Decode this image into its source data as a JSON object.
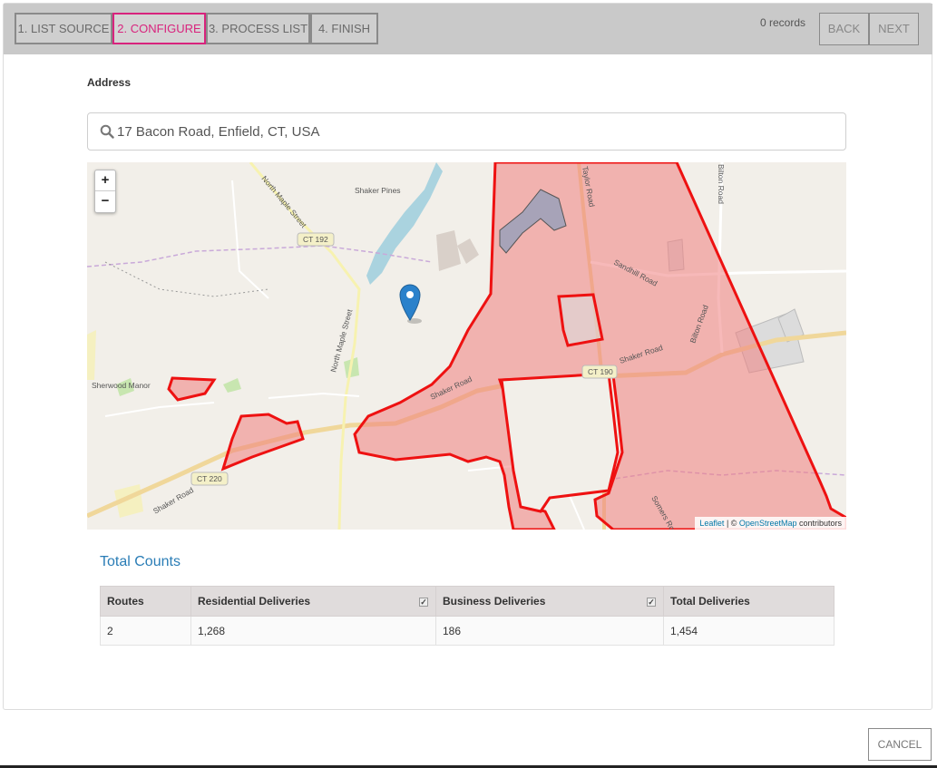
{
  "wizard": {
    "steps": [
      {
        "label": "1. LIST SOURCE"
      },
      {
        "label": "2. CONFIGURE"
      },
      {
        "label": "3. PROCESS LIST"
      },
      {
        "label": "4. FINISH"
      }
    ],
    "active_step": 2,
    "records": "0 records",
    "back_label": "BACK",
    "next_label": "NEXT"
  },
  "address": {
    "label": "Address",
    "value": "17 Bacon Road, Enfield, CT, USA"
  },
  "map": {
    "zoom_in": "+",
    "zoom_out": "−",
    "attribution_leaflet": "Leaflet",
    "attribution_sep": " | © ",
    "attribution_osm": "OpenStreetMap",
    "attribution_tail": " contributors",
    "labels": {
      "shaker_pines": "Shaker Pines",
      "ct192": "CT 192",
      "north_maple_1": "North Maple Street",
      "north_maple_2": "North Maple Street",
      "taylor_road": "Taylor Road",
      "sandhill_road": "Sandhill Road",
      "bilton_road_1": "Bilton Road",
      "bilton_road_2": "Bilton Road",
      "shaker_road_1": "Shaker Road",
      "shaker_road_2": "Shaker Road",
      "shaker_road_3": "Shaker Road",
      "ct190": "CT 190",
      "sherwood_manor": "Sherwood Manor",
      "ct220": "CT 220",
      "somers_road": "Somers Ro"
    },
    "colors": {
      "route_fill": "#f08080",
      "route_stroke": "#ee1111",
      "marker": "#2a81cb"
    }
  },
  "counts": {
    "title": "Total Counts",
    "headers": {
      "routes": "Routes",
      "residential": "Residential Deliveries",
      "business": "Business Deliveries",
      "total": "Total Deliveries"
    },
    "row": {
      "routes": "2",
      "residential": "1,268",
      "business": "186",
      "total": "1,454"
    },
    "residential_checked": true,
    "business_checked": true
  },
  "cancel_label": "CANCEL",
  "colors": {
    "accent": "#d8237d",
    "link": "#2a7db6"
  }
}
